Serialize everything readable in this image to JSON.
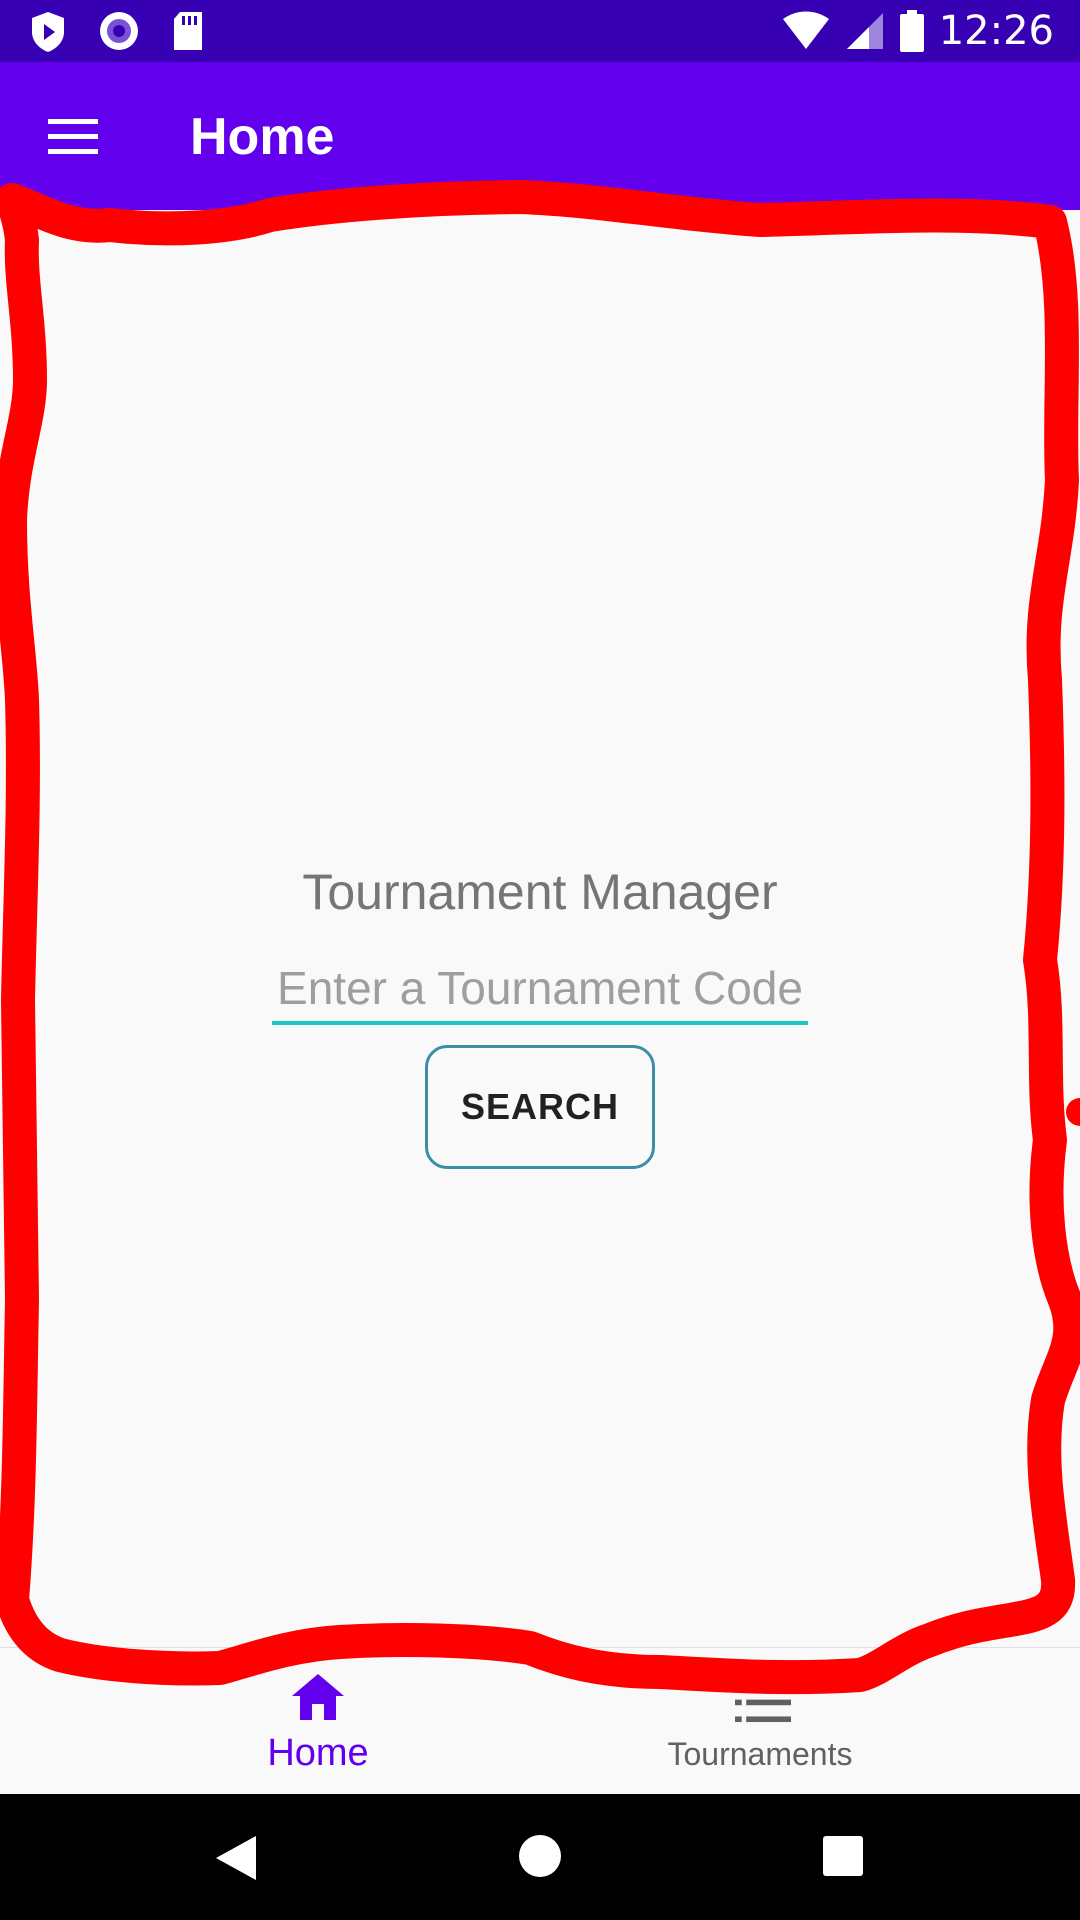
{
  "status_bar": {
    "time": "12:26",
    "icons": [
      "play-protect-icon",
      "radio-icon",
      "sd-card-icon",
      "wifi-icon",
      "signal-icon",
      "battery-icon"
    ]
  },
  "app_bar": {
    "title": "Home",
    "menu_icon": "hamburger-menu-icon"
  },
  "main": {
    "heading": "Tournament Manager",
    "code_input": {
      "placeholder": "Enter a Tournament Code",
      "value": ""
    },
    "search_button": "SEARCH"
  },
  "bottom_nav": {
    "items": [
      {
        "label": "Home",
        "icon": "home-icon",
        "selected": true
      },
      {
        "label": "Tournaments",
        "icon": "list-icon",
        "selected": false
      }
    ]
  },
  "system_nav": [
    "back-icon",
    "home-circle-icon",
    "recents-icon"
  ],
  "colors": {
    "status_bar": "#3700b3",
    "app_bar": "#6200ee",
    "accent": "#1ac6c0",
    "button_border": "#3a8fa6",
    "annotation": "#ff0000"
  }
}
